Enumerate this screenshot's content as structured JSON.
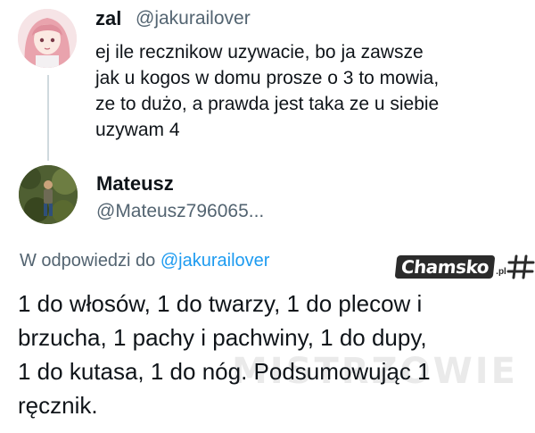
{
  "tweet": {
    "author_name": "zal",
    "author_handle": "@jakurailover",
    "text_lines": [
      "ej ile recznikow uzywacie, bo ja zawsze",
      "jak u kogos w domu prosze o 3 to mowia,",
      "ze to dużo, a prawda jest taka ze u siebie",
      "uzywam 4"
    ]
  },
  "reply": {
    "author_name": "Mateusz",
    "author_handle": "@Mateusz796065...",
    "reply_to_prefix": "W odpowiedzi do",
    "reply_to_mention": "@jakurailover",
    "text_lines": [
      "1 do włosów, 1 do twarzy, 1 do plecow i",
      "brzucha, 1 pachy i pachwiny, 1 do dupy,",
      "1 do kutasa, 1 do nóg. Podsumowując 1",
      "ręcznik."
    ]
  },
  "watermarks": {
    "logo_word": "Chamsko",
    "logo_tld": ".pl",
    "faint_text": "MISTRZOWIE"
  },
  "icons": {
    "avatar1": "anime-girl-avatar",
    "avatar2": "person-in-forest-avatar",
    "logo_mark": "hashtag-logo-icon"
  }
}
